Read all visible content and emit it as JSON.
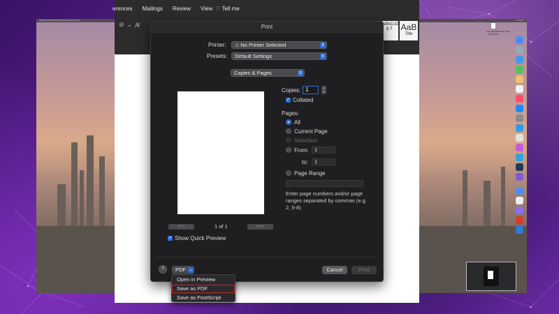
{
  "mac_menubar": {
    "left_text": "Microsoft Word  File  Edit  View  Insert  Format",
    "right_text": "Fri 10:11"
  },
  "word": {
    "tabs": [
      "erences",
      "Mailings",
      "Review",
      "View",
      "Tell me"
    ],
    "style_box_1": {
      "big": "AaBbCcDdEe",
      "label": "g 2"
    },
    "style_box_2": {
      "big": "AaB",
      "label": "Title"
    }
  },
  "print_dialog": {
    "title": "Print",
    "printer_label": "Printer:",
    "printer_value": "No Printer Selected",
    "presets_label": "Presets:",
    "presets_value": "Default Settings",
    "section_value": "Copies & Pages",
    "copies_label": "Copies:",
    "copies_value": "1",
    "collated_label": "Collated",
    "pages_label": "Pages:",
    "opt_all": "All",
    "opt_current": "Current Page",
    "opt_selection": "Selection",
    "opt_from": "From:",
    "from_value": "1",
    "to_label": "to:",
    "to_value": "1",
    "opt_range": "Page Range",
    "range_hint": "Enter page numbers and/or page ranges separated by commas (e.g. 2, 5-8)",
    "page_indicator": "1 of 1",
    "nav_first": "<<  <",
    "nav_last": ">  >>",
    "show_preview_label": "Show Quick Preview",
    "help": "?",
    "pdf_label": "PDF",
    "cancel_label": "Cancel",
    "print_label": "Print"
  },
  "pdf_menu": {
    "items": [
      "Open in Preview",
      "Save as PDF",
      "Save as PostScript"
    ]
  },
  "desktop_file": {
    "name": "Ask.sap.flash.2019-10-40",
    "subtitle": "fix 40.00.01"
  },
  "colors": {
    "accent": "#2f6fd9",
    "highlight_outline": "#c62828",
    "sheet_bg": "#1f1f21"
  },
  "icons": {
    "help": "question-icon",
    "warning": "warning-triangle-icon",
    "popup": "chevron-updown-icon"
  }
}
